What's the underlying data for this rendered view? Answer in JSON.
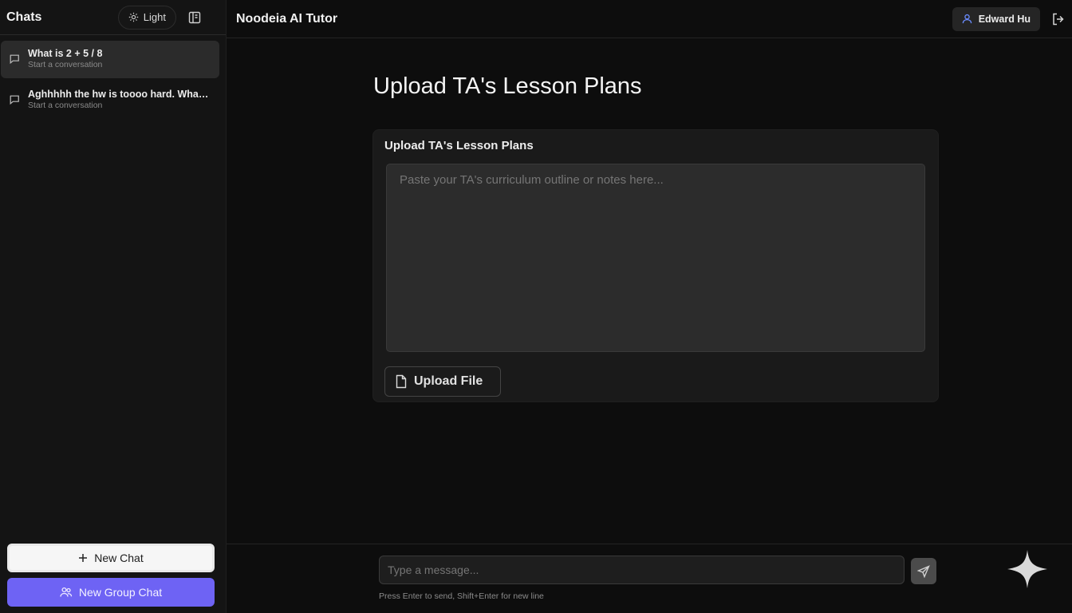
{
  "sidebar": {
    "title": "Chats",
    "theme_toggle": "Light",
    "chats": [
      {
        "title": "What is 2 + 5 / 8",
        "subtitle": "Start a conversation"
      },
      {
        "title": "Aghhhhh the hw is toooo hard. What ...",
        "subtitle": "Start a conversation"
      }
    ],
    "new_chat": "New Chat",
    "new_group_chat": "New Group Chat"
  },
  "header": {
    "app_title": "Noodeia AI Tutor",
    "user_name": "Edward Hu"
  },
  "main": {
    "page_title": "Upload TA's Lesson Plans",
    "panel_heading": "Upload TA's Lesson Plans",
    "textarea_placeholder": "Paste your TA's curriculum outline or notes here...",
    "upload_button": "Upload File"
  },
  "composer": {
    "placeholder": "Type a message...",
    "hint": "Press Enter to send, Shift+Enter for new line"
  },
  "colors": {
    "background": "#0d0d0d",
    "sidebar": "#141414",
    "accent": "#6e63f4",
    "active_chat": "#2b2b2b"
  },
  "icons": [
    "sun-icon",
    "sidebar-toggle-icon",
    "chat-bubble-icon",
    "user-icon",
    "logout-icon",
    "plus-icon",
    "group-icon",
    "file-icon",
    "send-icon",
    "sparkle-icon"
  ]
}
